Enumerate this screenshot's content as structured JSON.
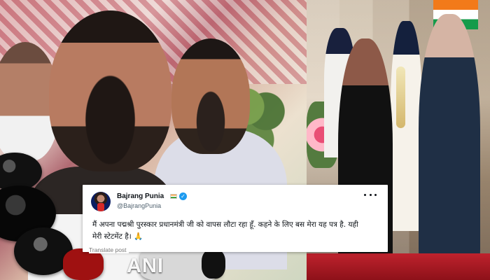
{
  "media": {
    "left_brand_text": "ANI"
  },
  "tweet": {
    "display_name": "Bajrang Punia",
    "handle": "@BajrangPunia",
    "body": "मैं अपना पद्मश्री पुरस्कार प्रधानमंत्री जी को वापस लौटा रहा हूँ. कहने के लिए बस मेरा यह पत्र है. यही मेरी स्टेटमेंट है। 🙏",
    "translate_label": "Translate post",
    "icons": {
      "flag": "india-flag-icon",
      "verified": "verified-badge-icon",
      "more": "more-options-icon"
    },
    "colors": {
      "verified": "#1d9bf0",
      "handle": "#536471",
      "text": "#0f1419"
    }
  }
}
